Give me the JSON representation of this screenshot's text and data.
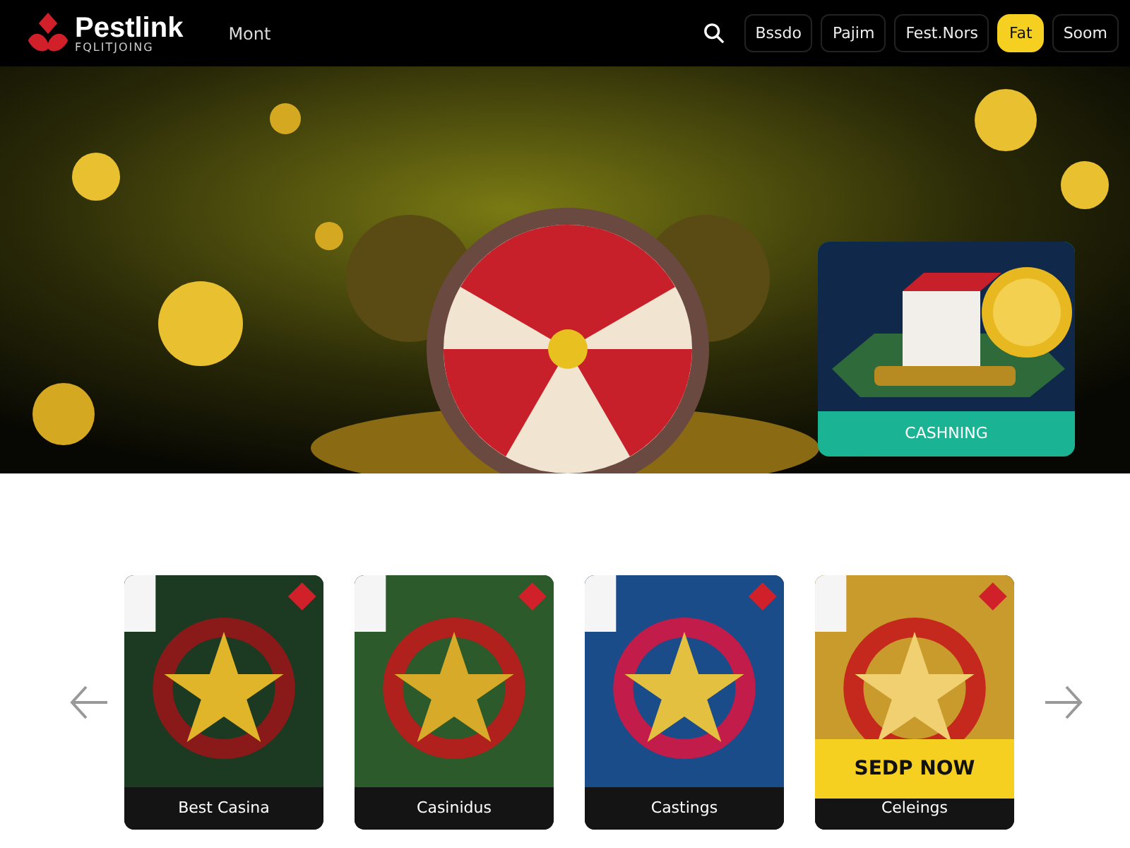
{
  "header": {
    "logo": {
      "name": "Pestlink",
      "tagline": "FQLITJOING"
    },
    "menu_link": "Mont",
    "nav_buttons": [
      {
        "label": "Bssdo",
        "selected": false
      },
      {
        "label": "Pajim",
        "selected": false
      },
      {
        "label": "Fest.Nors",
        "selected": false
      },
      {
        "label": "Fat",
        "selected": true
      },
      {
        "label": "Soom",
        "selected": false
      }
    ]
  },
  "hero": {
    "promo_card": {
      "caption": "CASHNING"
    }
  },
  "games": [
    {
      "caption": "Best Casina"
    },
    {
      "caption": "Casinidus"
    },
    {
      "caption": "Castings"
    },
    {
      "caption": "Celeings",
      "cta": "SEDP NOW"
    }
  ]
}
